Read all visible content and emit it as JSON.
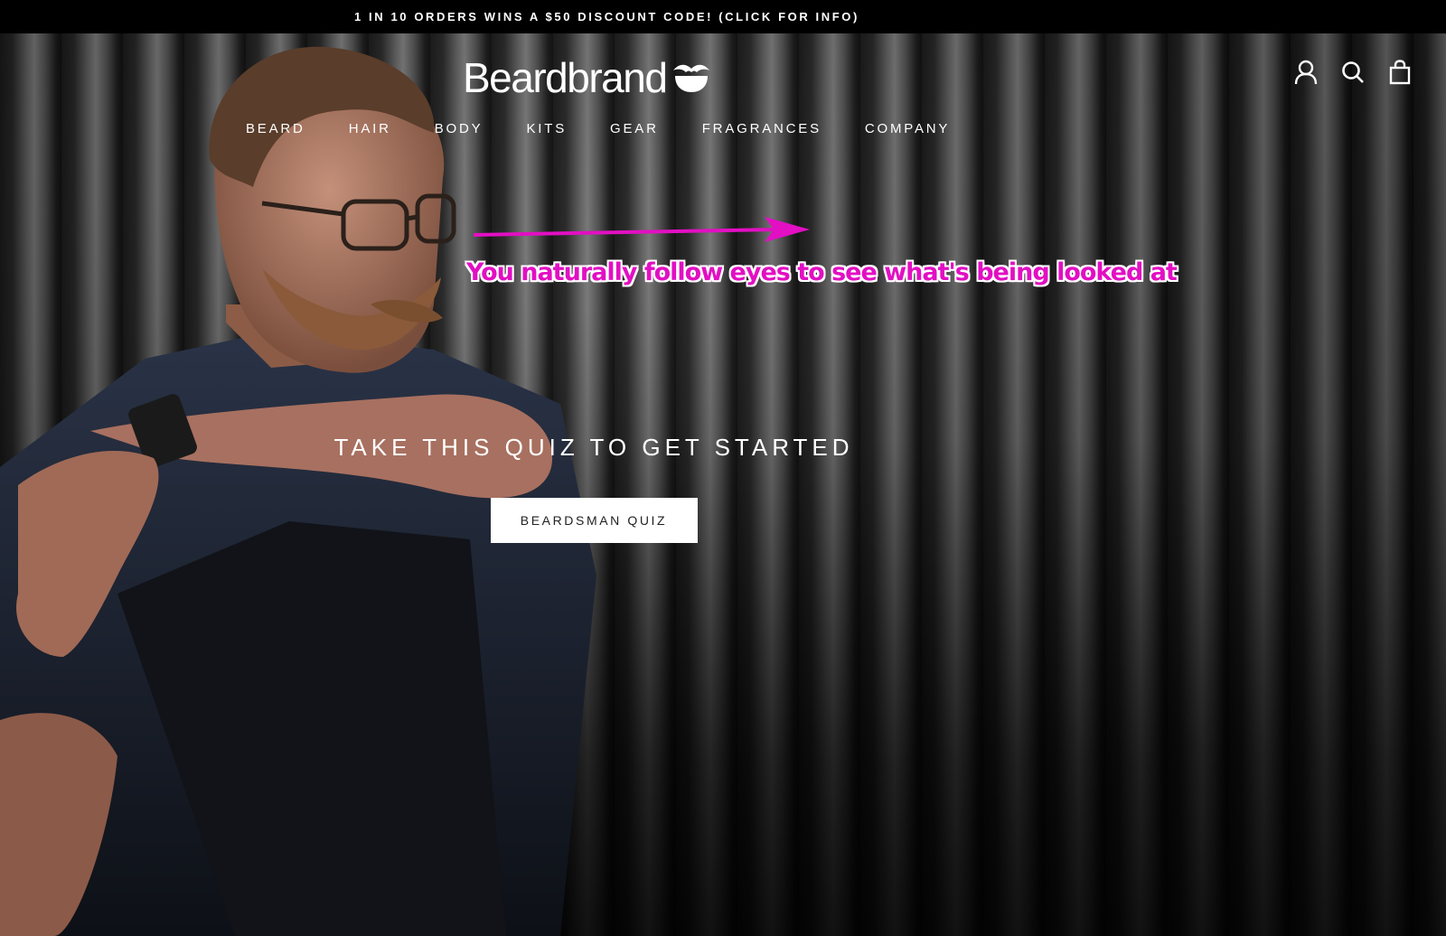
{
  "announcement": {
    "text": "1 IN 10 ORDERS WINS A $50 DISCOUNT CODE! (CLICK FOR INFO)"
  },
  "header": {
    "logo_text": "Beardbrand",
    "icons": [
      "account-icon",
      "search-icon",
      "cart-icon"
    ]
  },
  "nav": {
    "items": [
      {
        "label": "BEARD"
      },
      {
        "label": "HAIR"
      },
      {
        "label": "BODY"
      },
      {
        "label": "KITS"
      },
      {
        "label": "GEAR"
      },
      {
        "label": "FRAGRANCES"
      },
      {
        "label": "COMPANY"
      }
    ]
  },
  "annotation": {
    "text": "You naturally follow eyes to see what's being looked at",
    "color": "#e20fc3"
  },
  "hero": {
    "title": "TAKE THIS QUIZ TO GET STARTED",
    "button_label": "BEARDSMAN QUIZ"
  }
}
